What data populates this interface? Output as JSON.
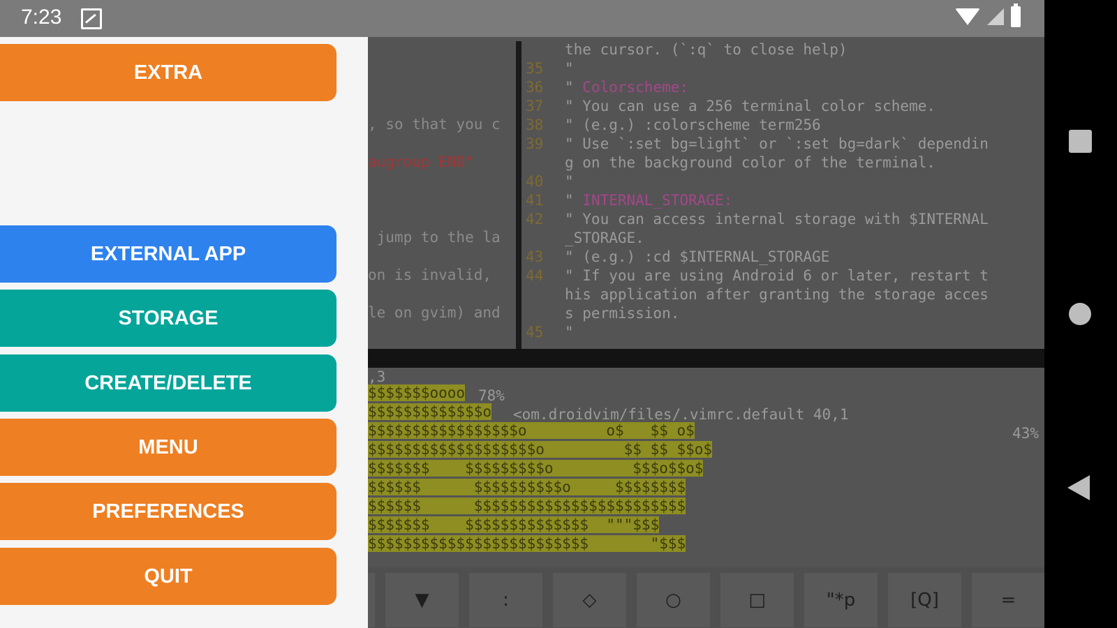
{
  "status_bar": {
    "time": "7:23"
  },
  "drawer": {
    "extra": "EXTRA",
    "external_app": "EXTERNAL APP",
    "storage": "STORAGE",
    "create_delete": "CREATE/DELETE",
    "menu": "MENU",
    "preferences": "PREFERENCES",
    "quit": "QUIT"
  },
  "editor": {
    "left_pane": [
      ", so that you c",
      "augroup END\"",
      " jump to the la",
      "on is invalid, ",
      "le on gvim) and"
    ],
    "lines": [
      {
        "num": "",
        "text": "the cursor. (`:q` to close help)"
      },
      {
        "num": "35",
        "text": "\""
      },
      {
        "num": "36",
        "text": "\" ",
        "pink": "Colorscheme:"
      },
      {
        "num": "37",
        "text": "\" You can use a 256 terminal color scheme."
      },
      {
        "num": "38",
        "text": "\" (e.g.) :colorscheme term256"
      },
      {
        "num": "39",
        "text": "\" Use `:set bg=light` or `:set bg=dark` dependin"
      },
      {
        "num": "",
        "text": "g on the background color of the terminal."
      },
      {
        "num": "40",
        "text": "\""
      },
      {
        "num": "41",
        "text": "\" ",
        "pink": "INTERNAL_STORAGE:"
      },
      {
        "num": "42",
        "text": "\" You can access internal storage with $INTERNAL"
      },
      {
        "num": "",
        "text": "_STORAGE."
      },
      {
        "num": "43",
        "text": "\" (e.g.) :cd $INTERNAL_STORAGE"
      },
      {
        "num": "44",
        "text": "\" If you are using Android 6 or later, restart t"
      },
      {
        "num": "",
        "text": "his application after granting the storage acces"
      },
      {
        "num": "",
        "text": "s permission."
      },
      {
        "num": "45",
        "text": "\""
      }
    ],
    "statusline_left": ",3",
    "statusline_left_pct": "78%",
    "statusline_file": "<om.droidvim/files/.vimrc.default 40,1",
    "statusline_right_pct": "43%",
    "ascii_art": [
      "$$$$$$$oooo",
      "$$$$$$$$$$$$$o",
      "$$$$$$$$$$$$$$$$$o         o$   $$ o$",
      "$$$$$$$$$$$$$$$$$$$o         $$ $$ $$o$",
      "$$$$$$$    $$$$$$$$$o         $$$o$$o$",
      "$$$$$$      $$$$$$$$$$o     $$$$$$$$",
      "$$$$$$      $$$$$$$$$$$$$$$$$$$$$$$$",
      "$$$$$$$    $$$$$$$$$$$$$$  \"\"\"$$$",
      "$$$$$$$$$$$$$$$$$$$$$$$$$       \"$$$"
    ],
    "keys": [
      "",
      "▼",
      ":",
      "◇",
      "○",
      "□",
      "\"*p",
      "[Q]",
      "="
    ]
  }
}
